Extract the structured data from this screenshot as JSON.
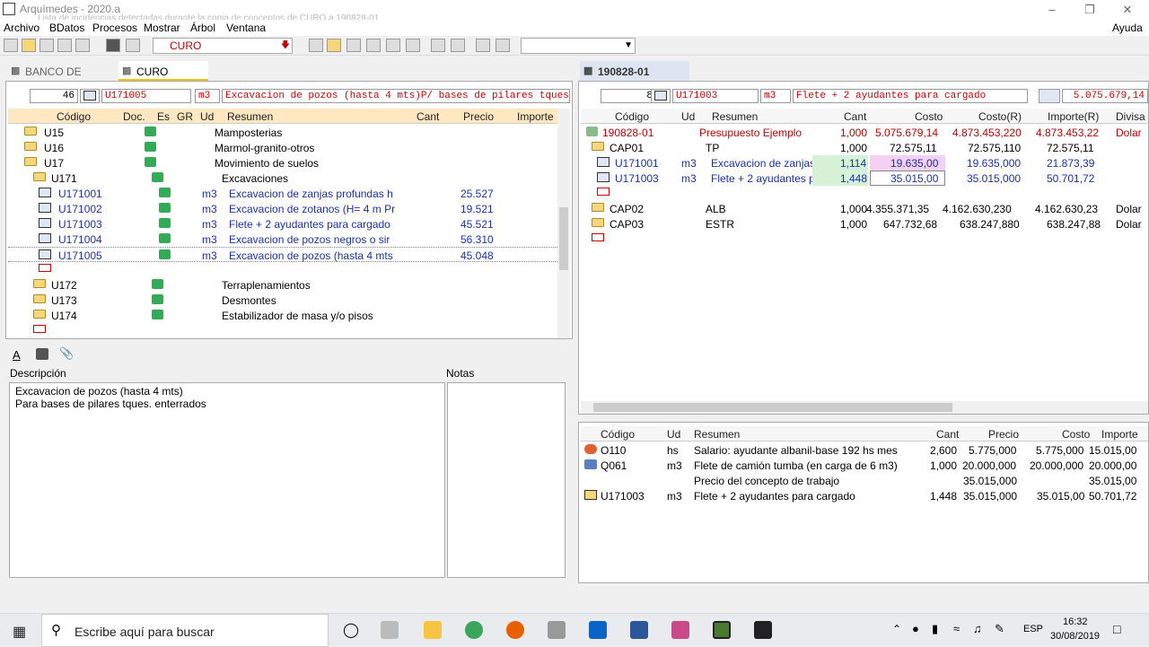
{
  "window": {
    "title": "Arquímedes - 2020.a",
    "ghost_text": "Lista de incidencias detectadas durante la copia de conceptos de CURO a 190828-01."
  },
  "menu": [
    "Archivo",
    "BDatos",
    "Procesos",
    "Mostrar",
    "Árbol",
    "Ventana"
  ],
  "help": "Ayuda y",
  "toolbar": {
    "combo_value": "CURO"
  },
  "left": {
    "tabs": [
      "BANCO DE",
      "CURO"
    ],
    "fields": {
      "count": "46",
      "code": "U171005",
      "unit": "m3",
      "desc": "Excavacion de pozos (hasta 4 mts)P/ bases de pilares tques."
    },
    "headers": [
      "Código",
      "Doc.",
      "Es",
      "GR",
      "Ud",
      "Resumen",
      "Cant",
      "Precio",
      "Importe"
    ],
    "rows": [
      {
        "code": "U15",
        "ud": "",
        "resumen": "Mamposterias",
        "precio": ""
      },
      {
        "code": "U16",
        "ud": "",
        "resumen": "Marmol-granito-otros",
        "precio": ""
      },
      {
        "code": "U17",
        "ud": "",
        "resumen": "Movimiento de suelos",
        "precio": ""
      },
      {
        "code": "U171",
        "ud": "",
        "resumen": "Excavaciones",
        "precio": ""
      },
      {
        "code": "U171001",
        "ud": "m3",
        "resumen": "Excavacion de zanjas profundas h",
        "precio": "25.527"
      },
      {
        "code": "U171002",
        "ud": "m3",
        "resumen": "Excavacion de zotanos (H= 4 m Pr",
        "precio": "19.521"
      },
      {
        "code": "U171003",
        "ud": "m3",
        "resumen": "Flete + 2 ayudantes para cargado",
        "precio": "45.521"
      },
      {
        "code": "U171004",
        "ud": "m3",
        "resumen": "Excavacion de pozos negros  o sir",
        "precio": "56.310"
      },
      {
        "code": "U171005",
        "ud": "m3",
        "resumen": "Excavacion de pozos (hasta 4 mts",
        "precio": "45.048"
      },
      {
        "code": "",
        "ud": "",
        "resumen": "",
        "precio": ""
      },
      {
        "code": "U172",
        "ud": "",
        "resumen": "Terraplenamientos",
        "precio": ""
      },
      {
        "code": "U173",
        "ud": "",
        "resumen": "Desmontes",
        "precio": ""
      },
      {
        "code": "U174",
        "ud": "",
        "resumen": "Estabilizador de masa y/o pisos",
        "precio": ""
      }
    ],
    "desc_label": "Descripción",
    "notes_label": "Notas",
    "description": [
      "Excavacion de pozos (hasta 4 mts)",
      "Para bases de pilares tques. enterrados"
    ]
  },
  "right": {
    "tab": "190828-01",
    "fields": {
      "count": "8",
      "code": "U171003",
      "unit": "m3",
      "desc": "Flete + 2 ayudantes para cargado",
      "total": "5.075.679,14"
    },
    "headers": [
      "Código",
      "Ud",
      "Resumen",
      "Cant",
      "Costo",
      "Costo(R)",
      "Importe(R)",
      "Divisa"
    ],
    "rows": [
      {
        "code": "190828-01",
        "ud": "",
        "resumen": "Presupuesto Ejemplo",
        "cant": "1,000",
        "costo": "5.075.679,14",
        "costor": "4.873.453,220",
        "importe": "4.873.453,22",
        "divisa": "Dolar"
      },
      {
        "code": "CAP01",
        "ud": "",
        "resumen": "TP",
        "cant": "1,000",
        "costo": "72.575,11",
        "costor": "72.575,110",
        "importe": "72.575,11",
        "divisa": ""
      },
      {
        "code": "U171001",
        "ud": "m3",
        "resumen": "Excavacion de zanjas",
        "cant": "1,114",
        "costo": "19.635,00",
        "costor": "19.635,000",
        "importe": "21.873,39",
        "divisa": ""
      },
      {
        "code": "U171003",
        "ud": "m3",
        "resumen": "Flete + 2 ayudantes p",
        "cant": "1,448",
        "costo": "35.015,00",
        "costor": "35.015,000",
        "importe": "50.701,72",
        "divisa": ""
      },
      {
        "code": "",
        "ud": "",
        "resumen": "",
        "cant": "",
        "costo": "",
        "costor": "",
        "importe": "",
        "divisa": ""
      },
      {
        "code": "CAP02",
        "ud": "",
        "resumen": "ALB",
        "cant": "1,000",
        "costo": "4.355.371,35",
        "costor": "4.162.630,230",
        "importe": "4.162.630,23",
        "divisa": "Dolar"
      },
      {
        "code": "CAP03",
        "ud": "",
        "resumen": "ESTR",
        "cant": "1,000",
        "costo": "647.732,68",
        "costor": "638.247,880",
        "importe": "638.247,88",
        "divisa": "Dolar"
      }
    ],
    "bottom_headers": [
      "Código",
      "Ud",
      "Resumen",
      "Cant",
      "Precio",
      "Costo",
      "Importe"
    ],
    "bottom_rows": [
      {
        "code": "O110",
        "ud": "hs",
        "resumen": "Salario: ayudante albanil-base 192 hs mes",
        "cant": "2,600",
        "precio": "5.775,000",
        "costo": "5.775,000",
        "importe": "15.015,00"
      },
      {
        "code": "Q061",
        "ud": "m3",
        "resumen": "Flete de camión tumba (en carga de 6 m3)",
        "cant": "1,000",
        "precio": "20.000,000",
        "costo": "20.000,000",
        "importe": "20.000,00"
      },
      {
        "code": "",
        "ud": "",
        "resumen": "Precio del concepto de trabajo",
        "cant": "",
        "precio": "35.015,000",
        "costo": "",
        "importe": "35.015,00"
      },
      {
        "code": "U171003",
        "ud": "m3",
        "resumen": "Flete + 2 ayudantes para cargado",
        "cant": "1,448",
        "precio": "35.015,000",
        "costo": "35.015,00",
        "importe": "50.701,72"
      }
    ]
  },
  "taskbar": {
    "search": "Escribe aquí para buscar",
    "lang": "ESP",
    "time": "16:32",
    "date": "30/08/2019"
  }
}
